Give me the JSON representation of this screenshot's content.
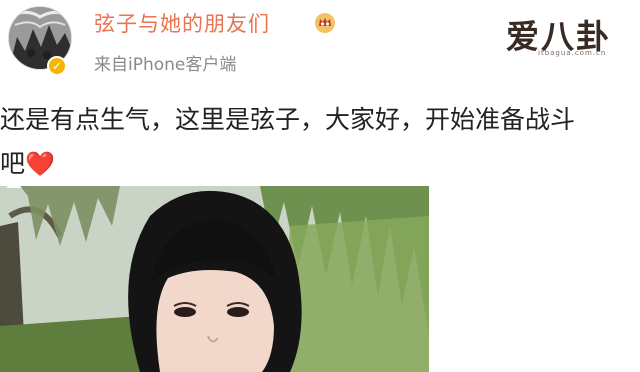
{
  "header": {
    "username": "弦子与她的朋友们",
    "source": "来自iPhone客户端",
    "verified_icon": "verified-badge-icon",
    "vip_icon": "vip-crown-icon"
  },
  "watermark": {
    "main": "爱八卦",
    "sub": "itbagua.com.cn"
  },
  "post": {
    "line1": "还是有点生气，这里是弦子，大家好，开始准备战斗",
    "line2": "吧",
    "heart": "❤️"
  },
  "colors": {
    "username": "#eb7350",
    "source": "#8a8a8a",
    "text": "#222222",
    "verified": "#f7b500",
    "heart": "#e0282e"
  }
}
